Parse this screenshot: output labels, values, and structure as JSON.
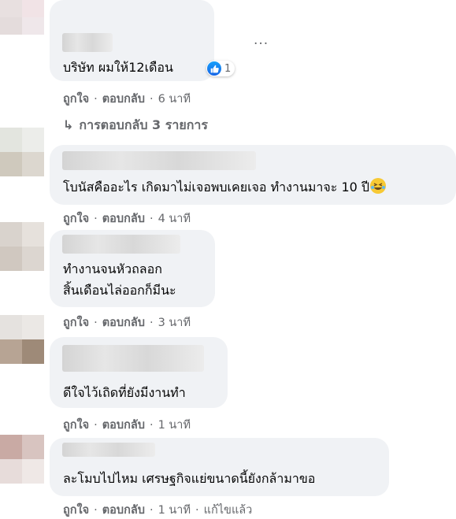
{
  "comments": [
    {
      "text_lines": [
        "บริษัท ผมให้12เดือน"
      ],
      "reaction_count": "1",
      "actions": {
        "like": "ถูกใจ",
        "reply": "ตอบกลับ",
        "time": "6 นาที"
      },
      "more_label": "···",
      "replies_label": "การตอบกลับ 3 รายการ"
    },
    {
      "text_lines": [
        "โบนัสคืออะไร เกิดมาไม่เจอพบเคยเจอ ทำงานมาจะ 10 ปี"
      ],
      "emoji": "rolling-on-floor-laughing",
      "actions": {
        "like": "ถูกใจ",
        "reply": "ตอบกลับ",
        "time": "4 นาที"
      }
    },
    {
      "text_lines": [
        "ทำงานจนหัวถลอก",
        "สิ้นเดือนไล่ออกก็มีนะ"
      ],
      "actions": {
        "like": "ถูกใจ",
        "reply": "ตอบกลับ",
        "time": "3 นาที"
      }
    },
    {
      "text_lines": [
        "ดีใจไว้เถิดที่ยังมีงานทำ"
      ],
      "actions": {
        "like": "ถูกใจ",
        "reply": "ตอบกลับ",
        "time": "1 นาที"
      }
    },
    {
      "text_lines": [
        "ละโมบไปไหม เศรษฐกิจแย่ขนาดนี้ยังกล้ามาขอ"
      ],
      "actions": {
        "like": "ถูกใจ",
        "reply": "ตอบกลับ",
        "time": "1 นาที",
        "edited": "แก้ไขแล้ว"
      }
    }
  ],
  "colors": {
    "bubble": "#f0f2f5",
    "meta": "#65676b",
    "like_blue": "#1877f2"
  }
}
